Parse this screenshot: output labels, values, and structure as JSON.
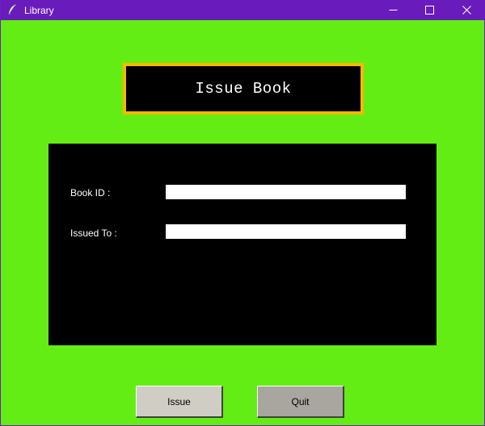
{
  "window": {
    "title": "Library",
    "icon": "feather-icon"
  },
  "heading": {
    "text": "Issue Book"
  },
  "form": {
    "book_id_label": "Book ID :",
    "book_id_value": "",
    "issued_to_label": "Issued To :",
    "issued_to_value": ""
  },
  "buttons": {
    "issue_label": "Issue",
    "quit_label": "Quit"
  },
  "colors": {
    "titlebar": "#6a1bbc",
    "background": "#64ed15",
    "heading_border": "#f7b800",
    "panel": "#000000"
  }
}
